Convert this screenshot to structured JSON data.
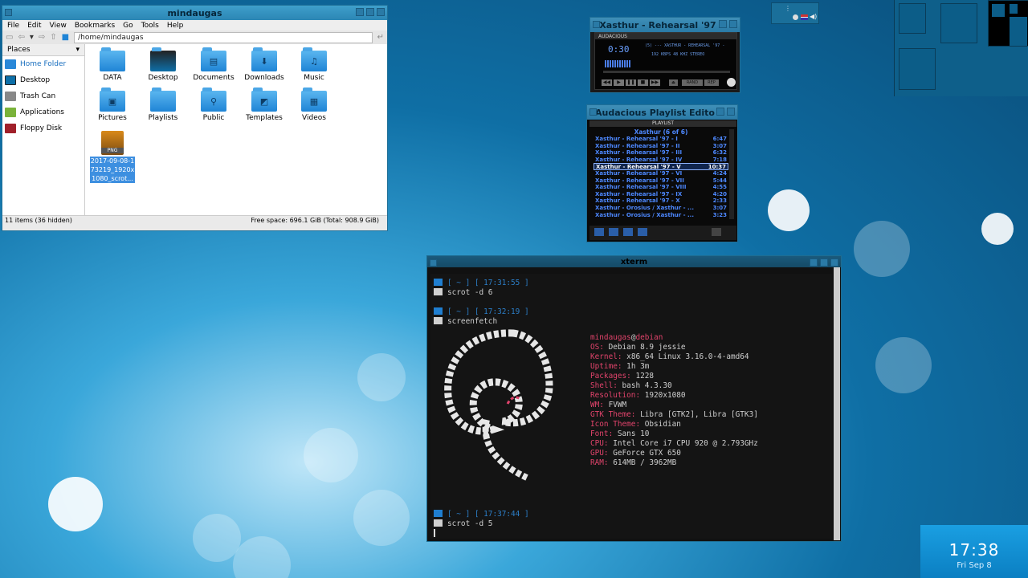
{
  "file_manager": {
    "title": "mindaugas",
    "menu": [
      "File",
      "Edit",
      "View",
      "Bookmarks",
      "Go",
      "Tools",
      "Help"
    ],
    "path": "/home/mindaugas",
    "places_header": "Places",
    "places": [
      "Home Folder",
      "Desktop",
      "Trash Can",
      "Applications",
      "Floppy Disk"
    ],
    "items": [
      "DATA",
      "Desktop",
      "Documents",
      "Downloads",
      "Music",
      "Pictures",
      "Playlists",
      "Public",
      "Templates",
      "Videos"
    ],
    "file_name_lines": [
      "2017-09-08-1",
      "73219_1920x",
      "1080_scrot..."
    ],
    "file_type": "PNG",
    "status_left": "11 items (36 hidden)",
    "status_right": "Free space: 696.1 GiB (Total: 908.9 GiB)"
  },
  "audacious": {
    "title": "Xasthur - Rehearsal '97",
    "header": "AUDACIOUS",
    "time": "0:30",
    "track_text": "(5) --- XASTHUR - REHEARSAL '97 -",
    "info_text": "192 KBPS  48 KHZ  STEREO",
    "buttons": [
      "◀◀",
      "▶",
      "❚❚",
      "■",
      "▶▶"
    ],
    "rand_label": "RAND",
    "rep_label": "REP"
  },
  "playlist": {
    "title": "Audacious Playlist Edito",
    "header": "PLAYLIST",
    "caption": "Xasthur (6 of 6)",
    "rows": [
      {
        "title": "Xasthur - Rehearsal '97 - I",
        "len": "6:47"
      },
      {
        "title": "Xasthur - Rehearsal '97 - II",
        "len": "3:07"
      },
      {
        "title": "Xasthur - Rehearsal '97 - III",
        "len": "6:32"
      },
      {
        "title": "Xasthur - Rehearsal '97 - IV",
        "len": "7:18"
      },
      {
        "title": "Xasthur - Rehearsal '97 - V",
        "len": "10:37"
      },
      {
        "title": "Xasthur - Rehearsal '97 - VI",
        "len": "4:24"
      },
      {
        "title": "Xasthur - Rehearsal '97 - VII",
        "len": "5:44"
      },
      {
        "title": "Xasthur - Rehearsal '97 - VIII",
        "len": "4:55"
      },
      {
        "title": "Xasthur - Rehearsal '97 - IX",
        "len": "4:20"
      },
      {
        "title": "Xasthur - Rehearsal '97 - X",
        "len": "2:33"
      },
      {
        "title": "Xasthur - Orosius / Xasthur - ...",
        "len": "3:07"
      },
      {
        "title": "Xasthur - Orosius / Xasthur - ...",
        "len": "3:23"
      }
    ],
    "selected_index": 4
  },
  "xterm": {
    "title": "xterm",
    "prompt1": "[ ~ ] [ 17:31:55 ]",
    "cmd1": "scrot -d 6",
    "prompt2": "[ ~ ] [ 17:32:19 ]",
    "cmd2": "screenfetch",
    "prompt3": "[ ~ ] [ 17:37:44 ]",
    "cmd3": "scrot -d 5",
    "user": "mindaugas",
    "host": "debian",
    "info": [
      {
        "k": "OS:",
        "v": "Debian 8.9 jessie"
      },
      {
        "k": "Kernel:",
        "v": "x86_64 Linux 3.16.0-4-amd64"
      },
      {
        "k": "Uptime:",
        "v": "1h 3m"
      },
      {
        "k": "Packages:",
        "v": "1228"
      },
      {
        "k": "Shell:",
        "v": "bash 4.3.30"
      },
      {
        "k": "Resolution:",
        "v": "1920x1080"
      },
      {
        "k": "WM:",
        "v": "FVWM"
      },
      {
        "k": "GTK Theme:",
        "v": "Libra [GTK2], Libra [GTK3]"
      },
      {
        "k": "Icon Theme:",
        "v": "Obsidian"
      },
      {
        "k": "Font:",
        "v": "Sans 10"
      },
      {
        "k": "CPU:",
        "v": "Intel Core i7 CPU 920 @ 2.793GHz"
      },
      {
        "k": "GPU:",
        "v": "GeForce GTX 650"
      },
      {
        "k": "RAM:",
        "v": "614MB / 3962MB"
      }
    ]
  },
  "clock": {
    "time": "17:38",
    "date": "Fri Sep 8"
  },
  "colors": {
    "accent": "#1f7ed0",
    "info_key": "#e0436b",
    "playlist_text": "#4d88ff"
  }
}
